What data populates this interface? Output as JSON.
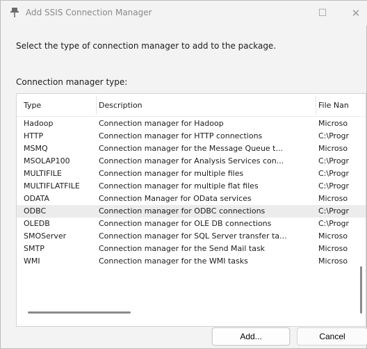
{
  "window": {
    "title": "Add SSIS Connection Manager",
    "maximize_glyph": "☐",
    "close_glyph": "✕",
    "icon": "ssis-pin-icon"
  },
  "instruction": "Select the type of connection manager to add to the package.",
  "list_label": "Connection manager type:",
  "table": {
    "columns": [
      "Type",
      "Description",
      "File Nan"
    ],
    "rows": [
      {
        "type": "Hadoop",
        "description": "Connection manager for Hadoop",
        "file": "Microso"
      },
      {
        "type": "HTTP",
        "description": "Connection manager for HTTP connections",
        "file": "C:\\Progr"
      },
      {
        "type": "MSMQ",
        "description": "Connection manager for the Message Queue t...",
        "file": "Microso"
      },
      {
        "type": "MSOLAP100",
        "description": "Connection manager for Analysis Services con...",
        "file": "C:\\Progr"
      },
      {
        "type": "MULTIFILE",
        "description": "Connection manager for multiple files",
        "file": "C:\\Progr"
      },
      {
        "type": "MULTIFLATFILE",
        "description": "Connection manager for multiple flat files",
        "file": "C:\\Progr"
      },
      {
        "type": "ODATA",
        "description": "Connection Manager for OData services",
        "file": "Microso"
      },
      {
        "type": "ODBC",
        "description": "Connection manager for ODBC connections",
        "file": "C:\\Progr",
        "selected": true
      },
      {
        "type": "OLEDB",
        "description": "Connection manager for OLE DB connections",
        "file": "C:\\Progr"
      },
      {
        "type": "SMOServer",
        "description": "Connection manager for SQL Server transfer ta...",
        "file": "Microso"
      },
      {
        "type": "SMTP",
        "description": "Connection manager for the Send Mail task",
        "file": "Microso"
      },
      {
        "type": "WMI",
        "description": "Connection manager for the WMI tasks",
        "file": "Microso"
      }
    ]
  },
  "buttons": {
    "add": "Add...",
    "cancel": "Cancel"
  },
  "colors": {
    "selected_row": "#ececec",
    "title_text": "#8a8a8a"
  }
}
